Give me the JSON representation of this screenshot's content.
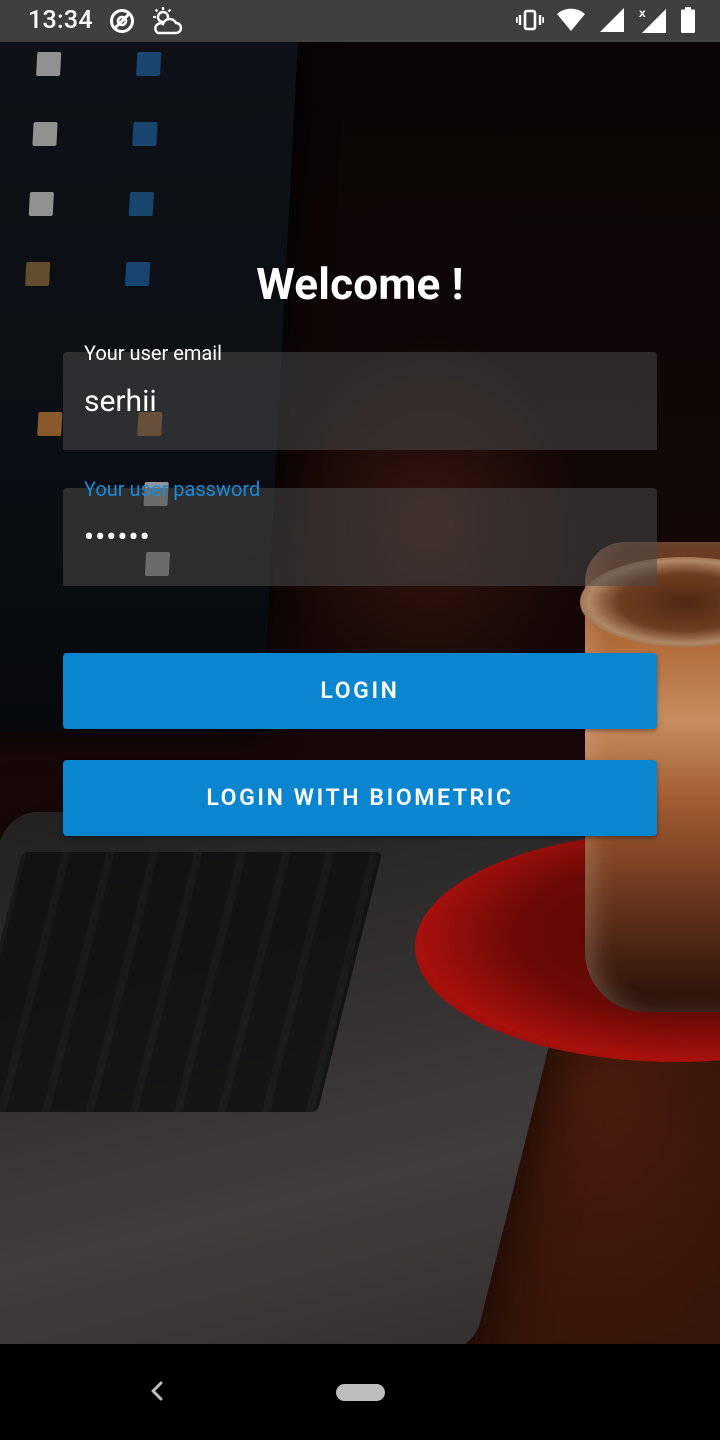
{
  "status_bar": {
    "time": "13:34",
    "left_icons": [
      "do-not-disturb-icon",
      "weather-partly-cloudy-icon"
    ],
    "right_icons": [
      "vibrate-icon",
      "wifi-icon",
      "signal-icon",
      "signal-no-data-icon",
      "battery-icon"
    ]
  },
  "login": {
    "title": "Welcome !",
    "email": {
      "label": "Your user email",
      "value": "serhii"
    },
    "password": {
      "label": "Your user password",
      "value": "••••••"
    },
    "login_button": "LOGIN",
    "biometric_button": "LOGIN WITH BIOMETRIC"
  },
  "colors": {
    "accent": "#0a86d1",
    "focused_label": "#1e8ad6",
    "status_bar": "#3f3f3f"
  },
  "nav_bar": {
    "icons": [
      "back-icon",
      "home-pill-icon"
    ]
  }
}
